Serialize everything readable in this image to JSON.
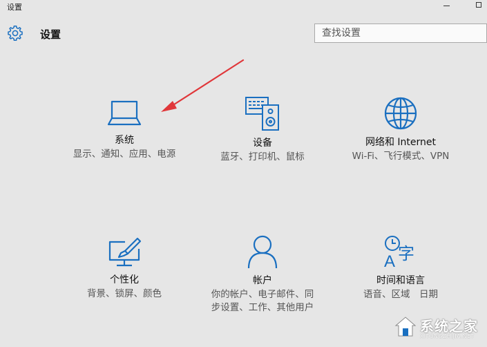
{
  "window": {
    "title": "设置"
  },
  "header": {
    "title": "设置",
    "search_placeholder": "查找设置"
  },
  "tiles": [
    {
      "title": "系统",
      "desc": "显示、通知、应用、电源",
      "icon": "laptop-icon"
    },
    {
      "title": "设备",
      "desc": "蓝牙、打印机、鼠标",
      "icon": "keyboard-speaker-icon"
    },
    {
      "title": "网络和 Internet",
      "desc": "Wi-Fi、飞行模式、VPN",
      "icon": "globe-icon"
    },
    {
      "title": "个性化",
      "desc": "背景、锁屏、颜色",
      "icon": "paint-monitor-icon"
    },
    {
      "title": "帐户",
      "desc": "你的帐户、电子邮件、同步设置、工作、其他用户",
      "icon": "person-icon"
    },
    {
      "title": "时间和语言",
      "desc": "语音、区域　日期",
      "icon": "clock-language-icon"
    }
  ],
  "colors": {
    "accent": "#1a6fc0",
    "background": "#e6e6e6",
    "arrow": "#e0373a"
  },
  "watermark": {
    "name": "系统之家",
    "url": "XITONGZHIJIA.NET"
  }
}
